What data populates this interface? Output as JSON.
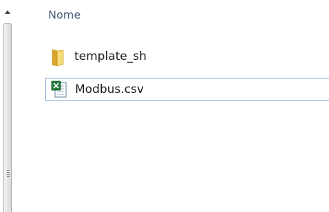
{
  "file_list": {
    "column_header": "Nome",
    "items": [
      {
        "name": "template_sh",
        "icon": "folder-icon"
      },
      {
        "name": "Modbus.csv",
        "icon": "excel-csv-icon"
      }
    ]
  },
  "colors": {
    "header_text": "#4c607a",
    "selection_border": "#7da2ce",
    "folder_fill": "#e8c04a",
    "excel_green": "#1f7a3a"
  }
}
